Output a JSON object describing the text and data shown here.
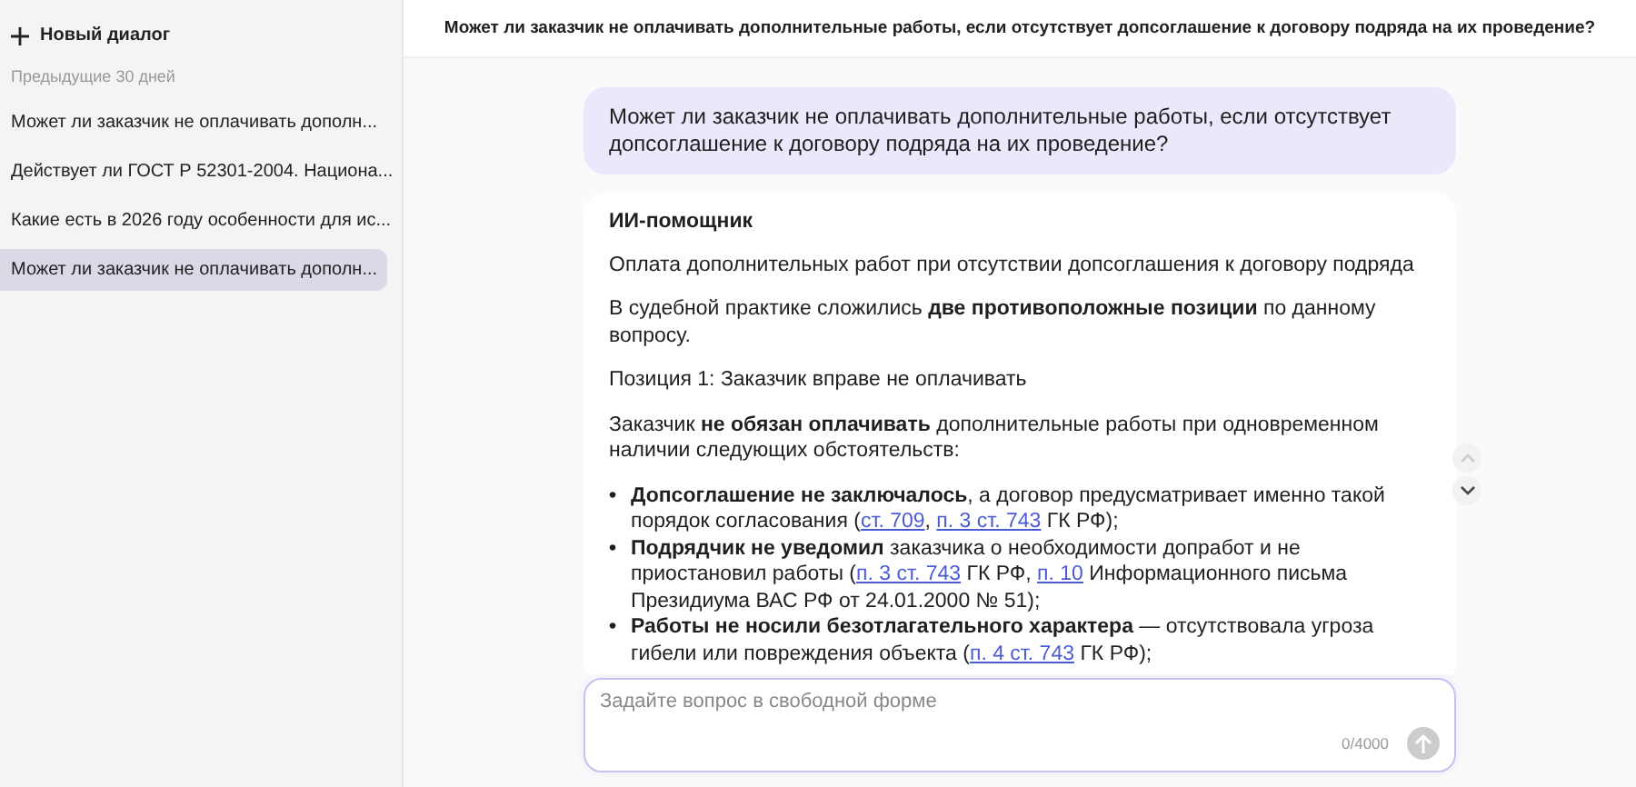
{
  "sidebar": {
    "new_dialog": "Новый диалог",
    "section_label": "Предыдущие 30 дней",
    "items": [
      {
        "label": "Может ли заказчик не оплачивать дополн...",
        "selected": false
      },
      {
        "label": "Действует ли ГОСТ Р 52301-2004. Национа...",
        "selected": false
      },
      {
        "label": "Какие есть в 2026 году особенности для ис...",
        "selected": false
      },
      {
        "label": "Может ли заказчик не оплачивать дополн...",
        "selected": true
      }
    ]
  },
  "header": {
    "title": "Может ли заказчик не оплачивать дополнительные работы, если отсутствует допсоглашение к договору подряда на их проведение?"
  },
  "user_message": "Может ли заказчик не оплачивать дополнительные работы, если отсутствует допсоглашение к договору подряда на их проведение?",
  "assistant": {
    "name": "ИИ-помощник",
    "paragraphs": [
      "Оплата дополнительных работ при отсутствии допсоглашения к договору подряда",
      "В судебной практике сложились **две противоположные позиции** по данному вопросу.",
      "Позиция 1: Заказчик вправе не оплачивать",
      "Заказчик **не обязан оплачивать** дополнительные работы при одновременном наличии следующих обстоятельств:"
    ],
    "bullets": [
      {
        "marker": "•",
        "segments": [
          {
            "kind": "text",
            "text": "**Допсоглашение не заключалось**, а договор предусматривает именно такой порядок согласования ("
          },
          {
            "kind": "link",
            "text": "ст. 709"
          },
          {
            "kind": "text",
            "text": ", "
          },
          {
            "kind": "link",
            "text": "п. 3 ст. 743"
          },
          {
            "kind": "text",
            "text": " ГК РФ);"
          }
        ]
      },
      {
        "marker": "•",
        "segments": [
          {
            "kind": "text",
            "text": "**Подрядчик не уведомил** заказчика о необходимости допработ и не приостановил работы ("
          },
          {
            "kind": "link",
            "text": "п. 3 ст. 743"
          },
          {
            "kind": "text",
            "text": " ГК РФ, "
          },
          {
            "kind": "link",
            "text": "п. 10"
          },
          {
            "kind": "text",
            "text": " Информационного письма Президиума ВАС РФ от 24.01.2000 № 51);"
          }
        ]
      },
      {
        "marker": "•",
        "segments": [
          {
            "kind": "text",
            "text": "**Работы не носили безотлагательного характера** — отсутствовала угроза гибели или повреждения объекта ("
          },
          {
            "kind": "link",
            "text": "п. 4 ст. 743"
          },
          {
            "kind": "text",
            "text": " ГК РФ);"
          }
        ]
      }
    ]
  },
  "input": {
    "placeholder": "Задайте вопрос в свободной форме",
    "counter": "0/4000"
  }
}
